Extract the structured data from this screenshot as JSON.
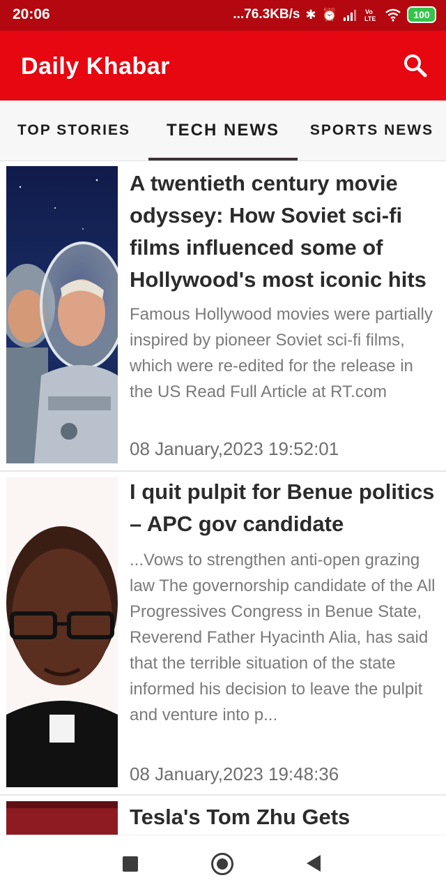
{
  "status_bar": {
    "time": "20:06",
    "network_speed": "...76.3KB/s",
    "battery": "100",
    "icons": [
      "bluetooth-icon",
      "alarm-icon",
      "signal-icon",
      "volte-icon",
      "wifi-icon",
      "battery-icon"
    ]
  },
  "app_bar": {
    "title": "Daily Khabar",
    "search_icon": "search-icon"
  },
  "tabs": [
    {
      "label": "TOP STORIES"
    },
    {
      "label": "TECH NEWS"
    },
    {
      "label": "SPORTS NEWS"
    }
  ],
  "articles": [
    {
      "title": "A twentieth century movie odyssey: How Soviet sci-fi films influenced some of Hollywood's most iconic hits",
      "description": "Famous Hollywood movies were partially inspired by pioneer Soviet sci-fi films, which were re-edited for the release in the US Read Full Article at RT.com",
      "date": "08 January,2023  19:52:01"
    },
    {
      "title": "I quit pulpit for Benue politics – APC gov candidate",
      "description": "...Vows to strengthen anti-open grazing law The governorship candidate of the All Progressives Congress in Benue State, Reverend Father Hyacinth Alia, has said that the terrible situation of the state informed his decision to leave the pulpit and venture into p...",
      "date": "08 January,2023  19:48:36"
    },
    {
      "title": "Tesla's Tom Zhu Gets"
    }
  ],
  "colors": {
    "status_bar": "#b3080f",
    "app_bar": "#e60711",
    "tab_background": "#f7f7f7",
    "tab_indicator": "#3a3332"
  }
}
